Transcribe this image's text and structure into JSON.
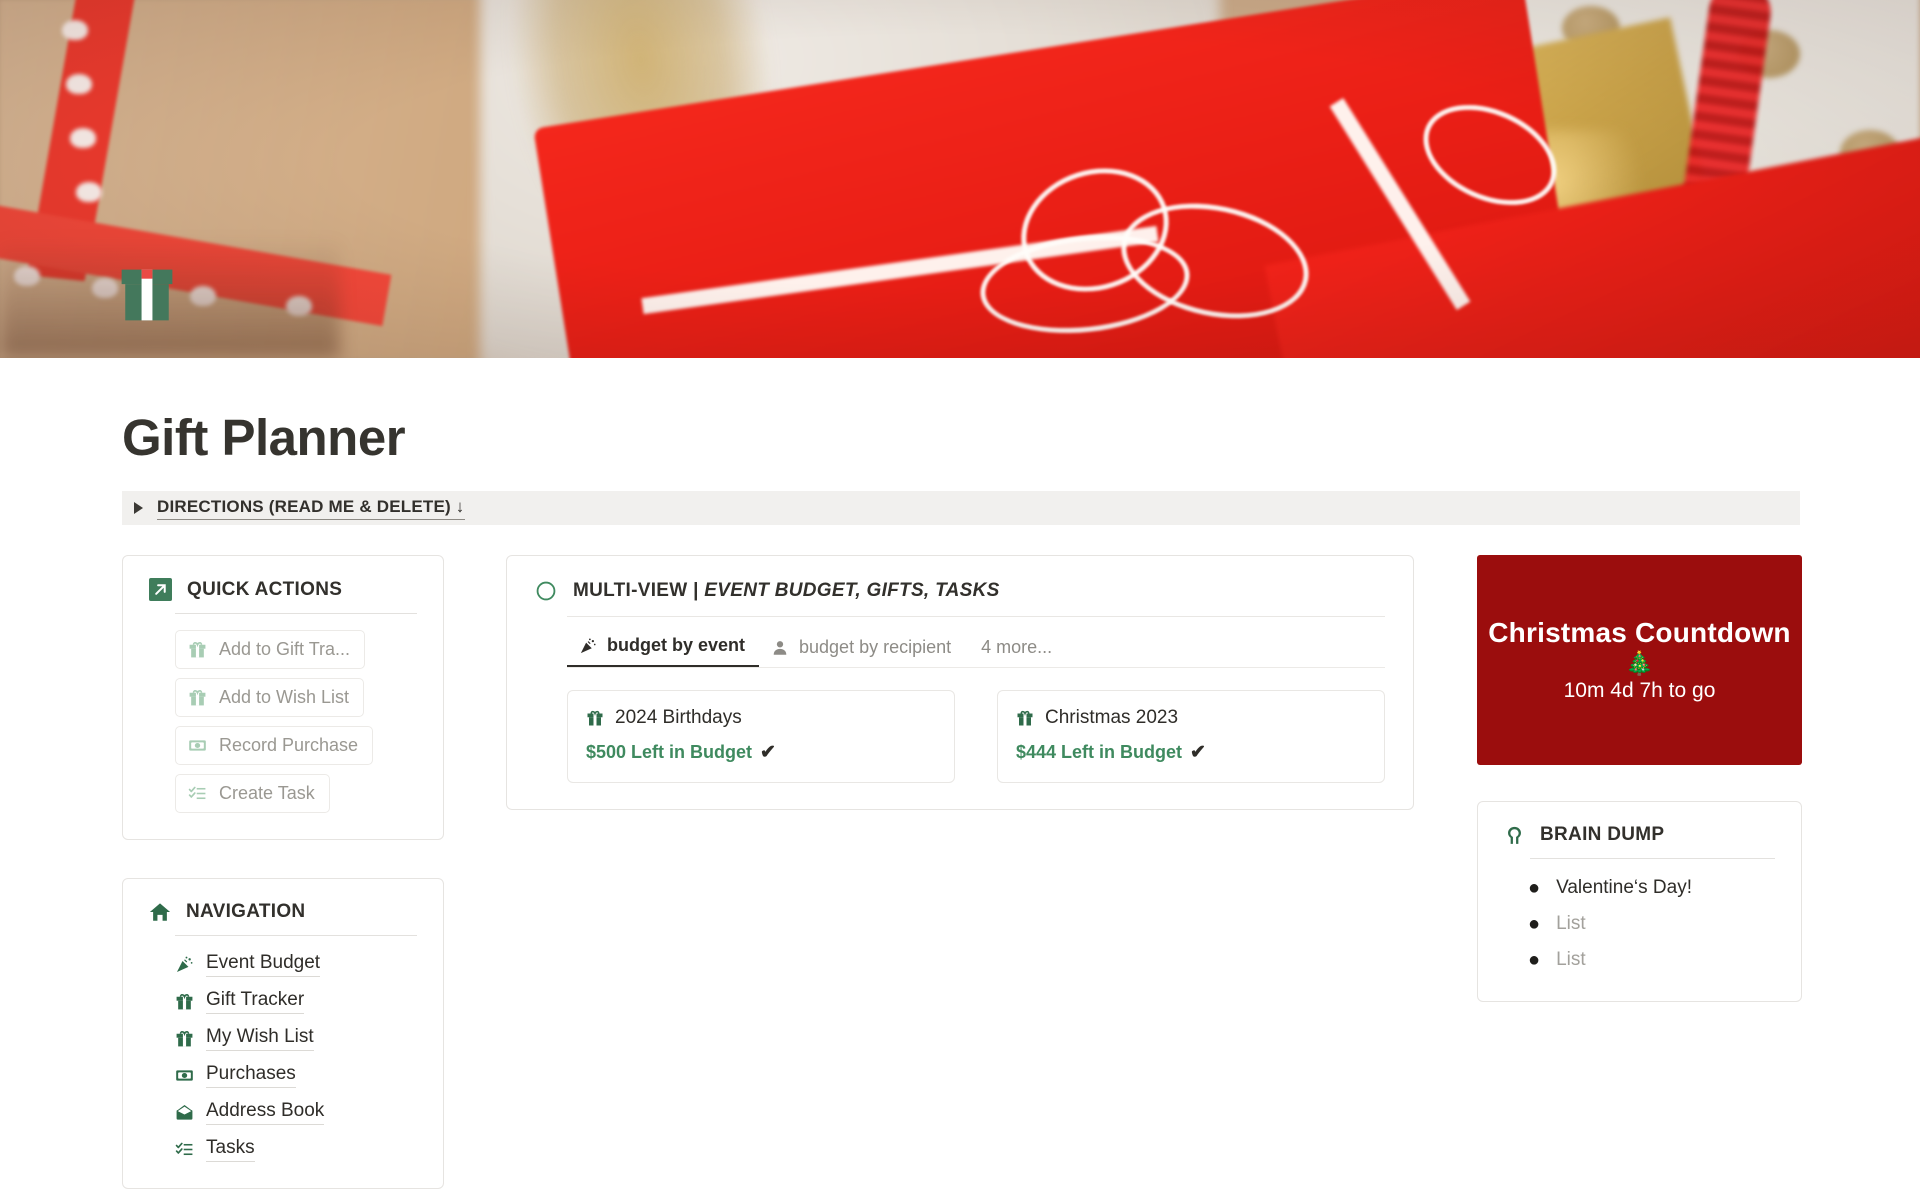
{
  "page": {
    "title": "Gift Planner",
    "icon": "gift-icon",
    "accent_green": "#3f7d5b",
    "accent_green_light": "#a8cdb4",
    "accent_red": "#9b0d0d"
  },
  "directions": {
    "label": "DIRECTIONS (READ ME & DELETE) ↓",
    "collapsed": true,
    "toggle_icon": "triangle-right-icon"
  },
  "quick_actions": {
    "title": "QUICK ACTIONS",
    "icon": "arrow-up-right-icon",
    "buttons": [
      {
        "label": "Add to Gift Tra...",
        "icon": "gift-icon"
      },
      {
        "label": "Add to Wish List",
        "icon": "gift-icon"
      },
      {
        "label": "Record Purchase",
        "icon": "banknote-icon"
      },
      {
        "label": "Create Task",
        "icon": "checklist-icon"
      }
    ]
  },
  "navigation": {
    "title": "NAVIGATION",
    "icon": "house-icon",
    "items": [
      {
        "label": "Event Budget",
        "icon": "party-popper-icon"
      },
      {
        "label": "Gift Tracker",
        "icon": "gift-icon"
      },
      {
        "label": "My Wish List",
        "icon": "gift-icon"
      },
      {
        "label": "Purchases",
        "icon": "banknote-icon"
      },
      {
        "label": "Address Book",
        "icon": "envelope-icon"
      },
      {
        "label": "Tasks",
        "icon": "checklist-icon"
      }
    ]
  },
  "multi_view": {
    "icon": "circle-outline-icon",
    "title_main": "MULTI-VIEW | ",
    "title_italic": "EVENT BUDGET, GIFTS, TASKS",
    "tabs": [
      {
        "label": "budget by event",
        "icon": "party-popper-icon",
        "active": true
      },
      {
        "label": "budget by recipient",
        "icon": "person-icon",
        "active": false
      }
    ],
    "more_tabs_label": "4 more...",
    "entries": [
      {
        "name": "2024 Birthdays",
        "icon": "gift-icon",
        "budget_text": "$500 Left in Budget",
        "check": "✔"
      },
      {
        "name": "Christmas 2023",
        "icon": "gift-icon",
        "budget_text": "$444 Left in Budget",
        "check": "✔"
      }
    ]
  },
  "countdown": {
    "title": "Christmas Countdown",
    "emoji": "🎄",
    "remaining": "10m 4d 7h to go"
  },
  "brain_dump": {
    "title": "BRAIN DUMP",
    "icon": "brain-icon",
    "items": [
      {
        "label": "Valentine‘s Day!",
        "placeholder": false
      },
      {
        "label": "List",
        "placeholder": true
      },
      {
        "label": "List",
        "placeholder": true
      }
    ]
  }
}
